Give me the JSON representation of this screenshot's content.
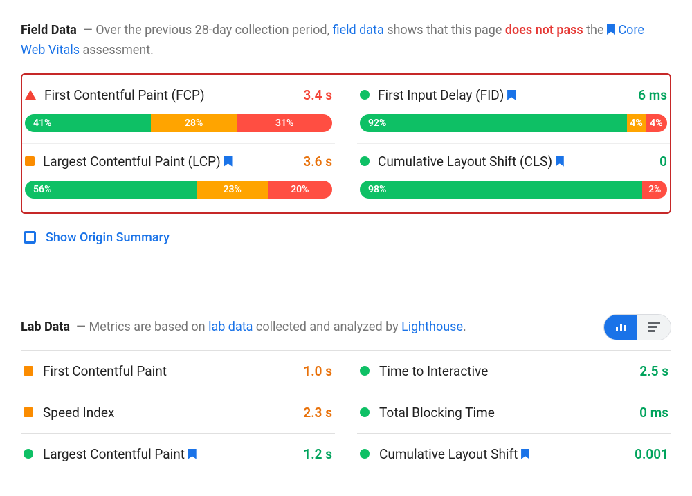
{
  "fieldData": {
    "title": "Field Data",
    "dash": "—",
    "text_before_link": "Over the previous 28-day collection period,",
    "link1": "field data",
    "text_mid": "shows that this page",
    "fail_text": "does not pass",
    "text_the": "the",
    "link2": "Core Web Vitals",
    "text_after": "assessment."
  },
  "fieldMetrics": [
    {
      "name": "First Contentful Paint (FCP)",
      "value": "3.4 s",
      "status": "poor",
      "bookmark": false,
      "dist": {
        "good": "41%",
        "ni": "28%",
        "poor": "31%",
        "goodW": 41,
        "niW": 28,
        "poorW": 31
      }
    },
    {
      "name": "First Input Delay (FID)",
      "value": "6 ms",
      "status": "good",
      "bookmark": true,
      "dist": {
        "good": "92%",
        "ni": "4%",
        "poor": "4%",
        "goodW": 87,
        "niW": 6,
        "poorW": 7
      }
    },
    {
      "name": "Largest Contentful Paint (LCP)",
      "value": "3.6 s",
      "status": "ni",
      "bookmark": true,
      "dist": {
        "good": "56%",
        "ni": "23%",
        "poor": "20%",
        "goodW": 56,
        "niW": 23,
        "poorW": 21
      }
    },
    {
      "name": "Cumulative Layout Shift (CLS)",
      "value": "0",
      "status": "good",
      "bookmark": true,
      "dist": {
        "good": "98%",
        "ni": "",
        "poor": "2%",
        "goodW": 92,
        "niW": 0,
        "poorW": 8
      }
    }
  ],
  "originSummary": "Show Origin Summary",
  "labData": {
    "title": "Lab Data",
    "dash": "—",
    "text_before": "Metrics are based on",
    "link1": "lab data",
    "text_mid": "collected and analyzed by",
    "link2": "Lighthouse",
    "period": "."
  },
  "labMetrics": [
    {
      "name": "First Contentful Paint",
      "value": "1.0 s",
      "status": "ni",
      "bookmark": false
    },
    {
      "name": "Time to Interactive",
      "value": "2.5 s",
      "status": "good",
      "bookmark": false
    },
    {
      "name": "Speed Index",
      "value": "2.3 s",
      "status": "ni",
      "bookmark": false
    },
    {
      "name": "Total Blocking Time",
      "value": "0 ms",
      "status": "good",
      "bookmark": false
    },
    {
      "name": "Largest Contentful Paint",
      "value": "1.2 s",
      "status": "good",
      "bookmark": true
    },
    {
      "name": "Cumulative Layout Shift",
      "value": "0.001",
      "status": "good",
      "bookmark": true
    }
  ]
}
